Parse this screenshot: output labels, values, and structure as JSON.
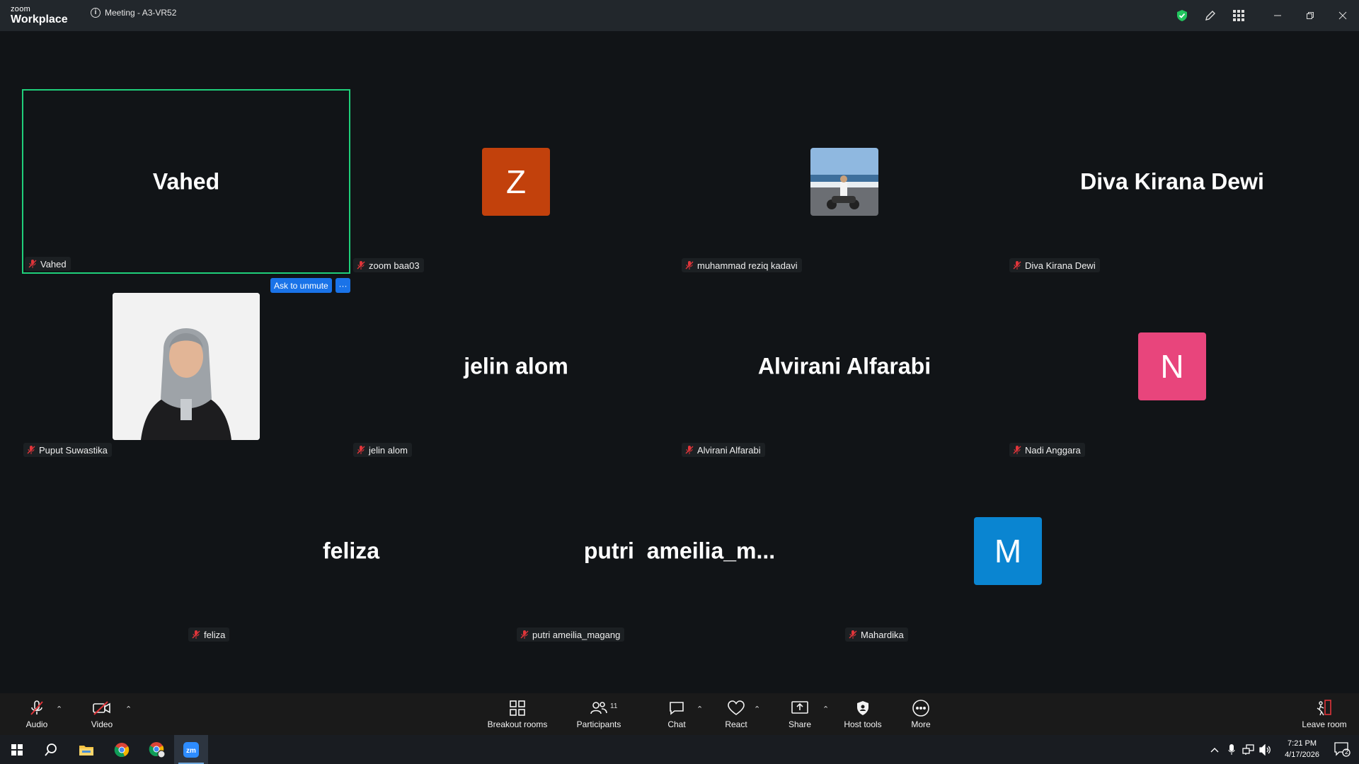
{
  "titlebar": {
    "logo_top": "zoom",
    "logo_bottom": "Workplace",
    "meeting_title": "Meeting - A3-VR52"
  },
  "colors": {
    "active_speaker_border": "#1fcf7a",
    "avatar_z": "#c2410c",
    "avatar_n": "#e8457c",
    "avatar_m": "#0a85d1",
    "ask_unmute": "#1a73e8",
    "muted_red": "#e0353a",
    "shield_green": "#22c55e",
    "leave_red": "#e0353a"
  },
  "tiles": [
    {
      "id": "vahed",
      "display": "Vahed",
      "tag": "Vahed"
    },
    {
      "id": "zoom-baa03",
      "display": "Z",
      "tag": "zoom baa03"
    },
    {
      "id": "muhammad",
      "display": "",
      "tag": "muhammad reziq kadavi"
    },
    {
      "id": "diva",
      "display": "Diva Kirana Dewi",
      "tag": "Diva Kirana Dewi"
    },
    {
      "id": "puput",
      "display": "",
      "tag": "Puput Suwastika"
    },
    {
      "id": "jelin",
      "display": "jelin alom",
      "tag": "jelin alom"
    },
    {
      "id": "alvirani",
      "display": "Alvirani Alfarabi",
      "tag": "Alvirani Alfarabi"
    },
    {
      "id": "nadi",
      "display": "N",
      "tag": "Nadi Anggara"
    },
    {
      "id": "feliza",
      "display": "feliza",
      "tag": "feliza"
    },
    {
      "id": "putri",
      "display": "putri  ameilia_m...",
      "tag": "putri ameilia_magang"
    },
    {
      "id": "mahardika",
      "display": "M",
      "tag": "Mahardika"
    }
  ],
  "ask_unmute": {
    "label": "Ask to unmute",
    "more": "···"
  },
  "toolbar": {
    "audio": "Audio",
    "video": "Video",
    "breakout": "Breakout rooms",
    "participants": "Participants",
    "participants_count": "11",
    "chat": "Chat",
    "react": "React",
    "share": "Share",
    "host_tools": "Host tools",
    "more": "More",
    "leave": "Leave room"
  },
  "taskbar": {
    "time": "7:21 PM",
    "date": "4/17/2026",
    "notifications": "2"
  }
}
